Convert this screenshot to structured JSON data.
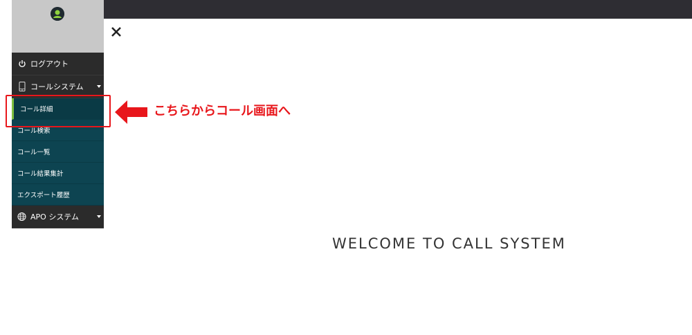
{
  "sidebar": {
    "logout_label": "ログアウト",
    "call_system_label": "コールシステム",
    "call_system_items": [
      {
        "label": "コール詳細"
      },
      {
        "label": "コール検索"
      },
      {
        "label": "コール一覧"
      },
      {
        "label": "コール結果集計"
      },
      {
        "label": "エクスポート履歴"
      }
    ],
    "apo_system_label": "APO システム"
  },
  "annotation": {
    "callout_text": "こちらからコール画面へ",
    "highlight_color": "#e8161b"
  },
  "main": {
    "welcome_text": "WELCOME TO CALL SYSTEM"
  },
  "colors": {
    "topbar": "#2e2d33",
    "menu_dark": "#2b2b2b",
    "submenu": "#0d4451",
    "active_marker": "#7fbf3f"
  },
  "icons": {
    "avatar": "user-avatar-icon",
    "logout": "power-icon",
    "call_system": "phone-icon",
    "apo_system": "globe-icon",
    "close": "close-icon",
    "arrow": "arrow-left-icon"
  }
}
